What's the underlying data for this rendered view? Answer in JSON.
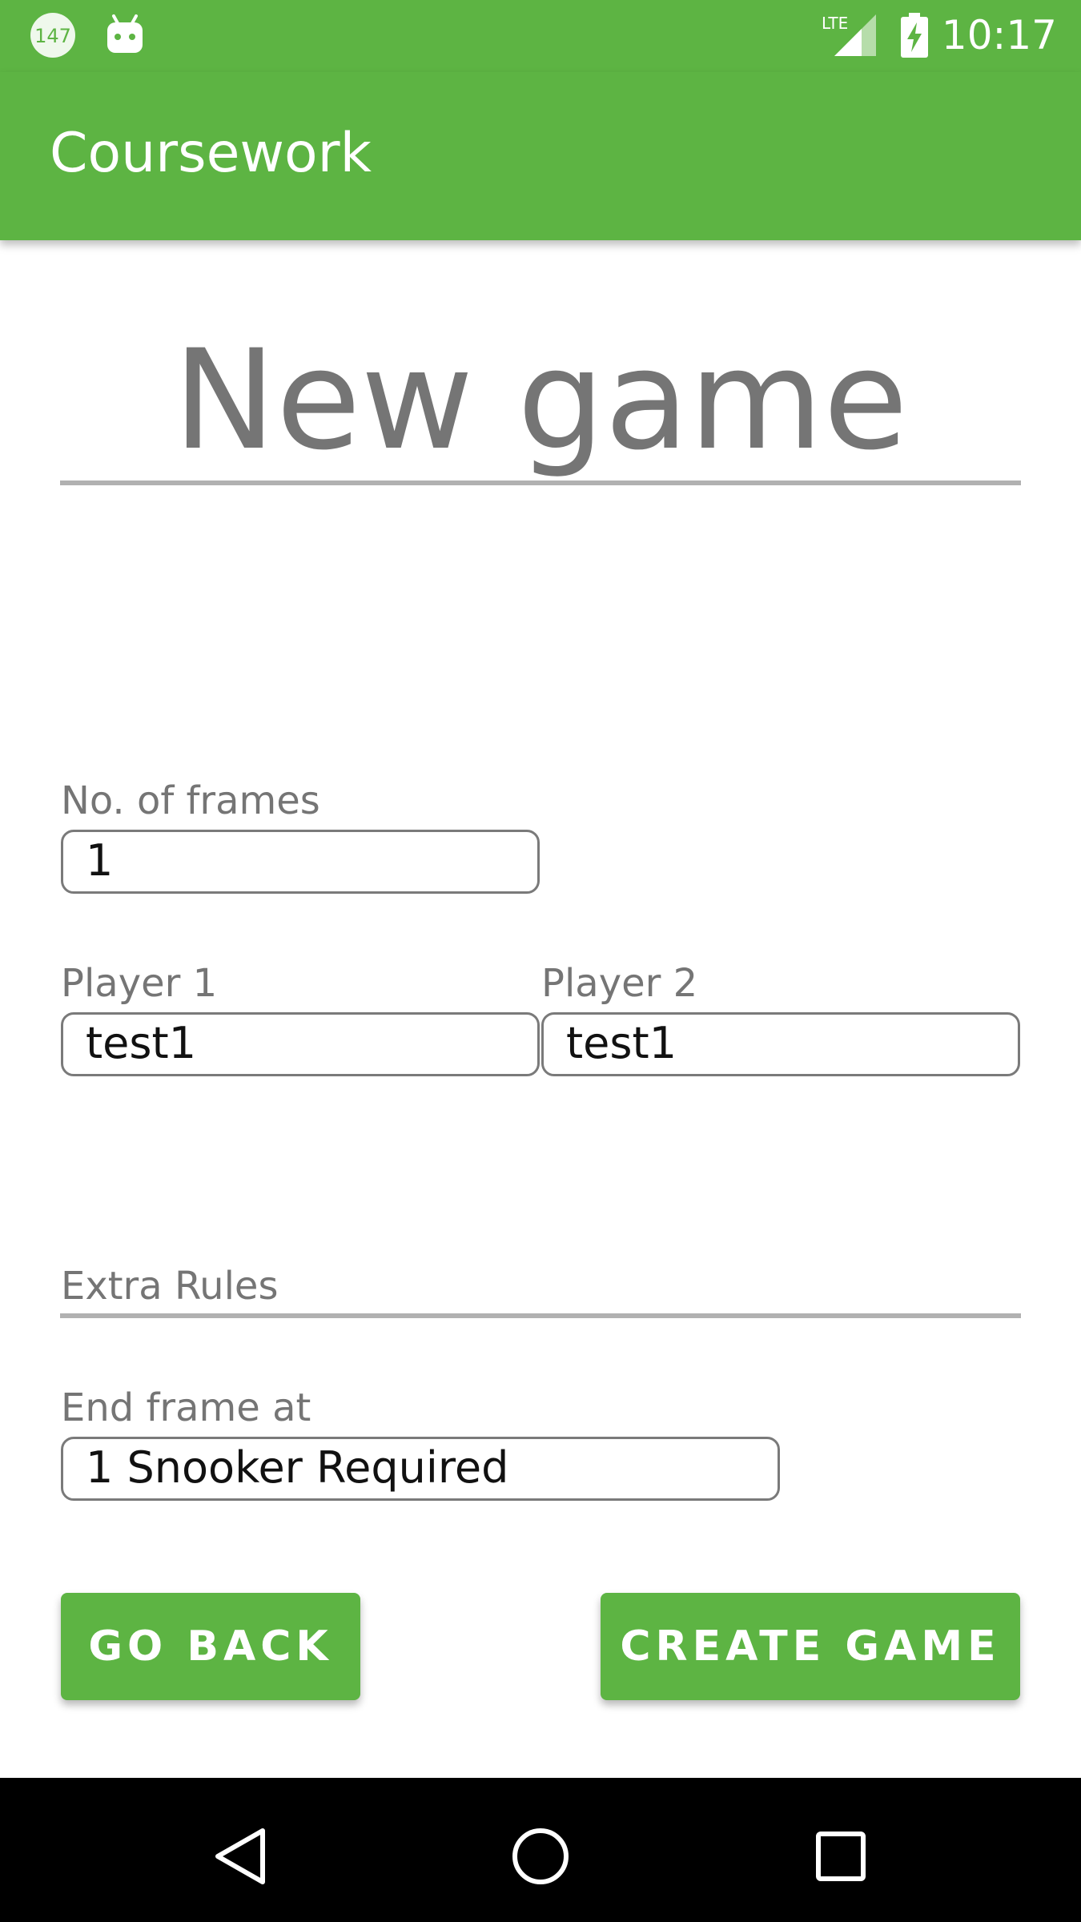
{
  "status_bar": {
    "notification_badge": "147",
    "time": "10:17",
    "network_label": "LTE",
    "icons": [
      "notification-count-icon",
      "android-icon",
      "signal-icon",
      "battery-charging-icon"
    ]
  },
  "app_bar": {
    "title": "Coursework"
  },
  "main": {
    "page_title": "New game",
    "frames": {
      "label": "No. of frames",
      "value": "1"
    },
    "player1": {
      "label": "Player 1",
      "value": "test1"
    },
    "player2": {
      "label": "Player 2",
      "value": "test1"
    },
    "extra_rules": {
      "label": "Extra Rules"
    },
    "end_frame": {
      "label": "End frame at",
      "value": "1 Snooker Required"
    },
    "buttons": {
      "back": "GO BACK",
      "create": "CREATE GAME"
    }
  },
  "nav_bar": {
    "icons": [
      "back-icon",
      "home-icon",
      "recents-icon"
    ]
  },
  "colors": {
    "accent": "#5db443",
    "label_gray": "#757575",
    "divider": "#b1b1b1",
    "nav_bg": "#000000"
  }
}
